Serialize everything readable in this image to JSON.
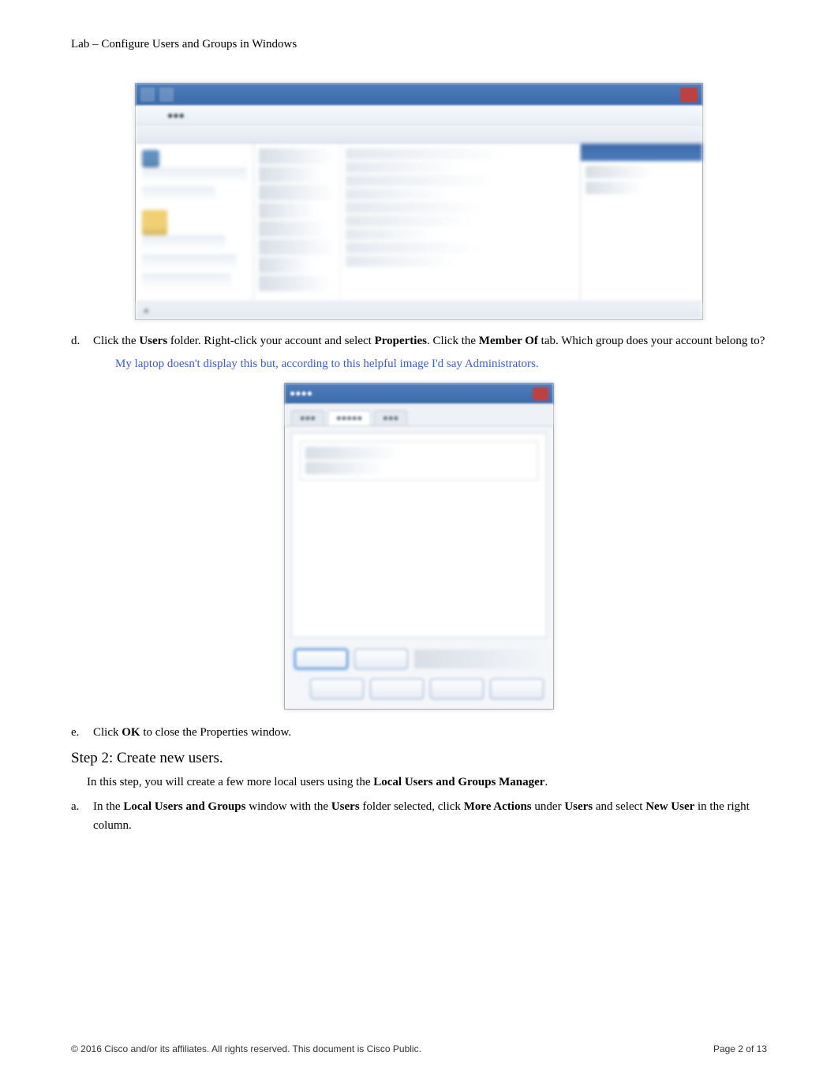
{
  "header": {
    "title": "Lab – Configure Users and Groups in Windows"
  },
  "screenshot1": {
    "status_text": "●"
  },
  "item_d": {
    "letter": "d.",
    "text_1": "Click the ",
    "bold_1": "Users",
    "text_2": " folder. Right-click your account and select ",
    "bold_2": "Properties",
    "text_3": ". Click the ",
    "bold_3": "Member Of",
    "text_4": " tab. Which group does your account belong to?"
  },
  "answer_d": "My laptop doesn't display this but, according to this helpful image I'd say Administrators.",
  "item_e": {
    "letter": "e.",
    "text_1": "Click ",
    "bold_1": "OK",
    "text_2": " to close the Properties window."
  },
  "step2": {
    "heading": "Step 2: Create new users.",
    "intro_1": "In this step, you will create a few more local users using the ",
    "intro_bold": "Local Users and Groups Manager",
    "intro_2": "."
  },
  "item_a": {
    "letter": "a.",
    "text_1": "In the ",
    "bold_1": "Local Users and Groups",
    "text_2": " window with the ",
    "bold_2": "Users",
    "text_3": " folder selected, click ",
    "bold_3": "More Actions",
    "text_4": " under ",
    "bold_4": "Users",
    "text_5": " and select ",
    "bold_5": "New User",
    "text_6": " in the right column."
  },
  "footer": {
    "copyright": "© 2016 Cisco and/or its affiliates. All rights reserved. This document is Cisco Public.",
    "page_label": "Page ",
    "page_num": "2 of 13"
  }
}
